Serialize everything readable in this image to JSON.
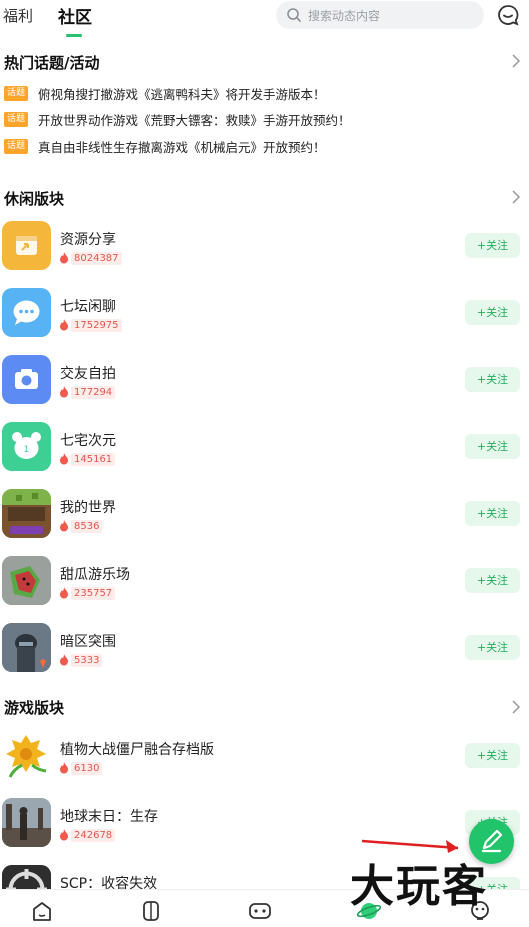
{
  "header": {
    "tabs": [
      {
        "label": "福利",
        "active": false
      },
      {
        "label": "社区",
        "active": true
      }
    ],
    "search_placeholder": "搜索动态内容"
  },
  "hot_topics": {
    "title": "热门话题/活动",
    "items": [
      {
        "badge": "话题",
        "text": "俯视角搜打撤游戏《逃离鸭科夫》将开发手游版本！"
      },
      {
        "badge": "话题",
        "text": "开放世界动作游戏《荒野大镖客：救赎》手游开放预约！"
      },
      {
        "badge": "话题",
        "text": "真自由非线性生存撤离游戏《机械启元》开放预约！"
      }
    ]
  },
  "casual_section": {
    "title": "休闲版块",
    "boards": [
      {
        "name": "资源分享",
        "heat": "8024387",
        "follow": "+关注",
        "icon": "share-icon"
      },
      {
        "name": "七坛闲聊",
        "heat": "1752975",
        "follow": "+关注",
        "icon": "chat-icon"
      },
      {
        "name": "交友自拍",
        "heat": "177294",
        "follow": "+关注",
        "icon": "camera-icon"
      },
      {
        "name": "七宅次元",
        "heat": "145161",
        "follow": "+关注",
        "icon": "bear-icon"
      },
      {
        "name": "我的世界",
        "heat": "8536",
        "follow": "+关注",
        "icon": "minecraft-icon"
      },
      {
        "name": "甜瓜游乐场",
        "heat": "235757",
        "follow": "+关注",
        "icon": "melon-icon"
      },
      {
        "name": "暗区突围",
        "heat": "5333",
        "follow": "+关注",
        "icon": "soldier-icon"
      }
    ]
  },
  "game_section": {
    "title": "游戏版块",
    "boards": [
      {
        "name": "植物大战僵尸融合存档版",
        "heat": "6130",
        "follow": "+关注",
        "icon": "plant-icon"
      },
      {
        "name": "地球末日：生存",
        "heat": "242678",
        "follow": "+关注",
        "icon": "survivor-icon"
      },
      {
        "name": "SCP：收容失效",
        "heat": "",
        "follow": "+关注",
        "icon": "scp-icon"
      }
    ]
  },
  "watermark": "大玩客",
  "colors": {
    "accent": "#22c46b",
    "badge": "#ffa42b",
    "heat": "#e4564f"
  }
}
